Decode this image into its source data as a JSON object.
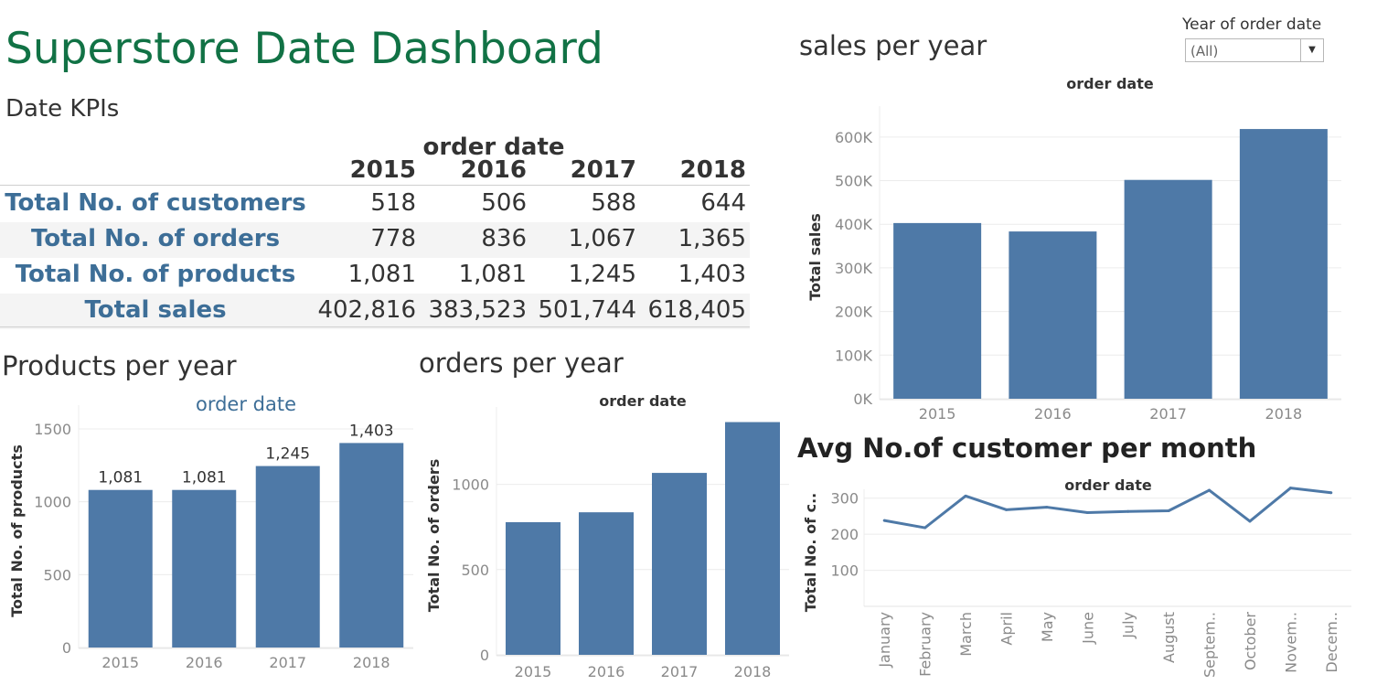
{
  "title": "Superstore Date Dashboard",
  "kpis": {
    "title": "Date KPIs",
    "header": "order date",
    "years": [
      "2015",
      "2016",
      "2017",
      "2018"
    ],
    "rows": [
      {
        "label": "Total No. of customers",
        "values": [
          "518",
          "506",
          "588",
          "644"
        ]
      },
      {
        "label": "Total No. of orders",
        "values": [
          "778",
          "836",
          "1,067",
          "1,365"
        ]
      },
      {
        "label": "Total No. of products",
        "values": [
          "1,081",
          "1,081",
          "1,245",
          "1,403"
        ]
      },
      {
        "label": "Total sales",
        "values": [
          "402,816",
          "383,523",
          "501,744",
          "618,405"
        ]
      }
    ]
  },
  "filter": {
    "label": "Year of order date",
    "value": "(All)"
  },
  "charts": {
    "sales": {
      "title": "sales per year",
      "subtitle": "order date",
      "ylabel": "Total sales"
    },
    "products": {
      "title": "Products per year",
      "subtitle": "order date",
      "ylabel": "Total No. of products"
    },
    "orders": {
      "title": "orders per year",
      "subtitle": "order date",
      "ylabel": "Total No. of orders"
    },
    "customers": {
      "title": "Avg No.of customer per month",
      "subtitle": "order date",
      "ylabel": "Total No. of c.."
    }
  },
  "colors": {
    "bar": "#4e79a7",
    "title": "#117245",
    "kpi_label": "#3d6e97"
  },
  "chart_data": [
    {
      "type": "bar",
      "title": "sales per year",
      "xlabel": "order date",
      "ylabel": "Total sales",
      "categories": [
        "2015",
        "2016",
        "2017",
        "2018"
      ],
      "values": [
        402816,
        383523,
        501744,
        618405
      ],
      "ylim": [
        0,
        650000
      ],
      "yticks": [
        0,
        100000,
        200000,
        300000,
        400000,
        500000,
        600000
      ],
      "ytick_labels": [
        "0K",
        "100K",
        "200K",
        "300K",
        "400K",
        "500K",
        "600K"
      ],
      "grid": true
    },
    {
      "type": "bar",
      "title": "Products per year",
      "xlabel": "order date",
      "ylabel": "Total No. of products",
      "categories": [
        "2015",
        "2016",
        "2017",
        "2018"
      ],
      "values": [
        1081,
        1081,
        1245,
        1403
      ],
      "data_labels": [
        "1,081",
        "1,081",
        "1,245",
        "1,403"
      ],
      "ylim": [
        0,
        1600
      ],
      "yticks": [
        0,
        500,
        1000,
        1500
      ],
      "ytick_labels": [
        "0",
        "500",
        "1000",
        "1500"
      ],
      "grid": true
    },
    {
      "type": "bar",
      "title": "orders per year",
      "xlabel": "order date",
      "ylabel": "Total No. of orders",
      "categories": [
        "2015",
        "2016",
        "2017",
        "2018"
      ],
      "values": [
        778,
        836,
        1067,
        1365
      ],
      "ylim": [
        0,
        1400
      ],
      "yticks": [
        0,
        500,
        1000
      ],
      "ytick_labels": [
        "0",
        "500",
        "1000"
      ],
      "grid": true
    },
    {
      "type": "line",
      "title": "Avg No.of customer per month",
      "xlabel": "order date",
      "ylabel": "Total No. of c..",
      "categories": [
        "January",
        "February",
        "March",
        "April",
        "May",
        "June",
        "July",
        "August",
        "Septem..",
        "October",
        "Novem..",
        "Decem.."
      ],
      "values": [
        238,
        218,
        306,
        268,
        275,
        260,
        263,
        265,
        322,
        236,
        328,
        315
      ],
      "ylim": [
        0,
        350
      ],
      "yticks": [
        100,
        200,
        300
      ],
      "ytick_labels": [
        "100",
        "200",
        "300"
      ],
      "grid": true
    }
  ]
}
